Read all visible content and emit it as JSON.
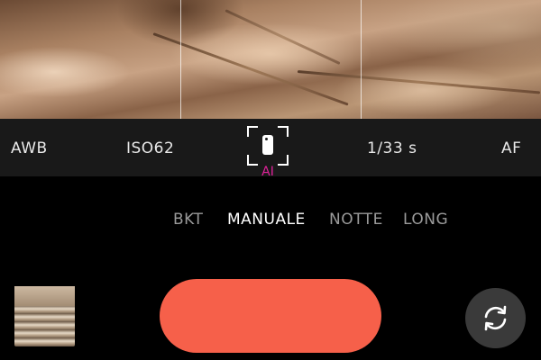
{
  "settings": {
    "white_balance": "AWB",
    "iso": "ISO62",
    "scene_mode": "AI",
    "shutter_speed": "1/33 s",
    "focus": "AF"
  },
  "modes": [
    "BKT",
    "MANUALE",
    "NOTTE",
    "LONG"
  ],
  "active_mode": "MANUALE",
  "colors": {
    "shutter": "#f6604a",
    "ai_accent": "#e0219a",
    "settings_bar": "#191919"
  },
  "icons": {
    "scene": "phone-icon",
    "switch_camera": "camera-switch-icon"
  }
}
